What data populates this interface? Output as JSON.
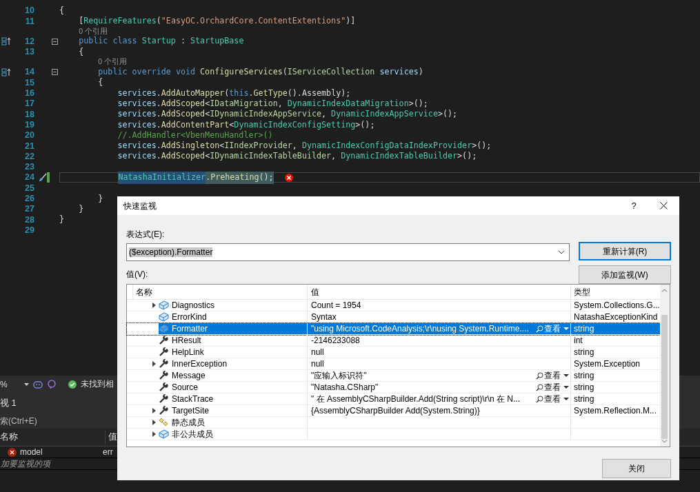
{
  "editor": {
    "lines": [
      {
        "number": "10",
        "fold": false,
        "tokens": [
          {
            "kind": "plain",
            "text": "{"
          }
        ]
      },
      {
        "number": "11",
        "fold": false,
        "tokens": [
          {
            "kind": "plain",
            "text": "    ["
          },
          {
            "kind": "type",
            "text": "RequireFeatures"
          },
          {
            "kind": "plain",
            "text": "("
          },
          {
            "kind": "str",
            "text": "\"EasyOC.OrchardCore.ContentExtentions\""
          },
          {
            "kind": "plain",
            "text": ")]"
          }
        ]
      },
      {
        "number": "12",
        "fold": true,
        "lens": "0 个引用",
        "kind": "override",
        "tokens": [
          {
            "kind": "kw",
            "text": "    public class "
          },
          {
            "kind": "type",
            "text": "Startup"
          },
          {
            "kind": "plain",
            "text": " : "
          },
          {
            "kind": "type",
            "text": "StartupBase"
          }
        ]
      },
      {
        "number": "13",
        "fold": false,
        "tokens": [
          {
            "kind": "plain",
            "text": "    {"
          }
        ]
      },
      {
        "number": "14",
        "fold": true,
        "lens": "0 个引用",
        "kind": "override",
        "tokens": [
          {
            "kind": "kw",
            "text": "        public override void "
          },
          {
            "kind": "method",
            "text": "ConfigureServices"
          },
          {
            "kind": "plain",
            "text": "("
          },
          {
            "kind": "iface",
            "text": "IServiceCollection"
          },
          {
            "kind": "var",
            "text": " services"
          },
          {
            "kind": "plain",
            "text": ")"
          }
        ]
      },
      {
        "number": "15",
        "fold": false,
        "tokens": [
          {
            "kind": "plain",
            "text": "        {"
          }
        ]
      },
      {
        "number": "16",
        "fold": false,
        "tokens": [
          {
            "kind": "var",
            "text": "            services"
          },
          {
            "kind": "plain",
            "text": "."
          },
          {
            "kind": "method",
            "text": "AddAutoMapper"
          },
          {
            "kind": "plain",
            "text": "("
          },
          {
            "kind": "kw",
            "text": "this"
          },
          {
            "kind": "plain",
            "text": "."
          },
          {
            "kind": "method",
            "text": "GetType"
          },
          {
            "kind": "plain",
            "text": "().Assembly);"
          }
        ]
      },
      {
        "number": "17",
        "fold": false,
        "tokens": [
          {
            "kind": "var",
            "text": "            services"
          },
          {
            "kind": "plain",
            "text": "."
          },
          {
            "kind": "method",
            "text": "AddScoped"
          },
          {
            "kind": "plain",
            "text": "<"
          },
          {
            "kind": "iface",
            "text": "IDataMigration"
          },
          {
            "kind": "plain",
            "text": ", "
          },
          {
            "kind": "type",
            "text": "DynamicIndexDataMigration"
          },
          {
            "kind": "plain",
            "text": ">();"
          }
        ]
      },
      {
        "number": "18",
        "fold": false,
        "tokens": [
          {
            "kind": "var",
            "text": "            services"
          },
          {
            "kind": "plain",
            "text": "."
          },
          {
            "kind": "method",
            "text": "AddScoped"
          },
          {
            "kind": "plain",
            "text": "<"
          },
          {
            "kind": "iface",
            "text": "IDynamicIndexAppService"
          },
          {
            "kind": "plain",
            "text": ", "
          },
          {
            "kind": "type",
            "text": "DynamicIndexAppService"
          },
          {
            "kind": "plain",
            "text": ">();"
          }
        ]
      },
      {
        "number": "19",
        "fold": false,
        "tokens": [
          {
            "kind": "var",
            "text": "            services"
          },
          {
            "kind": "plain",
            "text": "."
          },
          {
            "kind": "method",
            "text": "AddContentPart"
          },
          {
            "kind": "plain",
            "text": "<"
          },
          {
            "kind": "type",
            "text": "DynamicIndexConfigSetting"
          },
          {
            "kind": "plain",
            "text": ">();"
          }
        ]
      },
      {
        "number": "20",
        "fold": false,
        "tokens": [
          {
            "kind": "comment",
            "text": "            //.AddHandler<VbenMenuHandler>()"
          }
        ]
      },
      {
        "number": "21",
        "fold": false,
        "tokens": [
          {
            "kind": "var",
            "text": "            services"
          },
          {
            "kind": "plain",
            "text": "."
          },
          {
            "kind": "method",
            "text": "AddSingleton"
          },
          {
            "kind": "plain",
            "text": "<"
          },
          {
            "kind": "iface",
            "text": "IIndexProvider"
          },
          {
            "kind": "plain",
            "text": ", "
          },
          {
            "kind": "type",
            "text": "DynamicIndexConfigDataIndexProvider"
          },
          {
            "kind": "plain",
            "text": ">();"
          }
        ]
      },
      {
        "number": "22",
        "fold": false,
        "tokens": [
          {
            "kind": "var",
            "text": "            services"
          },
          {
            "kind": "plain",
            "text": "."
          },
          {
            "kind": "method",
            "text": "AddScoped"
          },
          {
            "kind": "plain",
            "text": "<"
          },
          {
            "kind": "iface",
            "text": "IDynamicIndexTableBuilder"
          },
          {
            "kind": "plain",
            "text": ", "
          },
          {
            "kind": "type",
            "text": "DynamicIndexTableBuilder"
          },
          {
            "kind": "plain",
            "text": ">();"
          }
        ]
      },
      {
        "number": "23",
        "fold": false
      },
      {
        "number": "24",
        "fold": false,
        "kind": "edit",
        "current": true,
        "error": true,
        "tokens": [
          {
            "kind": "type",
            "text": "            NatashaInitializer",
            "selected": true
          },
          {
            "kind": "method",
            "text": ".Preheating",
            "selected": false
          },
          {
            "kind": "plain",
            "text": "();",
            "selected": false
          }
        ]
      },
      {
        "number": "25",
        "fold": false
      },
      {
        "number": "26",
        "fold": false,
        "tokens": [
          {
            "kind": "plain",
            "text": "        }"
          }
        ]
      },
      {
        "number": "27",
        "fold": false,
        "tokens": [
          {
            "kind": "plain",
            "text": "    }"
          }
        ]
      },
      {
        "number": "28",
        "fold": false,
        "tokens": [
          {
            "kind": "plain",
            "text": "}"
          }
        ]
      },
      {
        "number": "29",
        "fold": false
      }
    ]
  },
  "toolbar": {
    "zoom": "%",
    "status": "未找到相"
  },
  "watch": {
    "title": "视 1",
    "search": "索(Ctrl+E)",
    "columns": [
      "名称",
      "值"
    ],
    "rows": [
      {
        "name": "model",
        "value": "err",
        "error": true
      }
    ],
    "add_hint": "加要监视的项"
  },
  "dialog": {
    "title": "快速监视",
    "help": "?",
    "expression_label": "表达式(E):",
    "expression": "($exception).Formatter",
    "buttons": [
      {
        "label": "重新计算(R)",
        "focused": true
      },
      {
        "label": "添加监视(W)",
        "focused": false
      }
    ],
    "value_label": "值(V):",
    "columns": [
      "名称",
      "值",
      "类型"
    ],
    "rows": [
      {
        "kind": "cube",
        "expandable": true,
        "name": "Diagnostics",
        "value": "Count = 1954",
        "type": "System.Collections.G...",
        "selected": false
      },
      {
        "kind": "cube",
        "expandable": false,
        "name": "ErrorKind",
        "value": "Syntax",
        "type": "NatashaExceptionKind",
        "selected": false
      },
      {
        "kind": "cube",
        "expandable": false,
        "name": "Formatter",
        "value": "\"using Microsoft.CodeAnalysis;\\r\\nusing System.Runtime....",
        "view": "查看",
        "type": "string",
        "selected": true
      },
      {
        "kind": "wrench",
        "expandable": false,
        "name": "HResult",
        "value": "-2146233088",
        "type": "int",
        "selected": false
      },
      {
        "kind": "wrench",
        "expandable": false,
        "name": "HelpLink",
        "value": "null",
        "type": "string",
        "selected": false
      },
      {
        "kind": "wrench",
        "expandable": true,
        "name": "InnerException",
        "value": "null",
        "type": "System.Exception",
        "selected": false
      },
      {
        "kind": "wrench",
        "expandable": false,
        "name": "Message",
        "value": "\"应输入标识符\"",
        "view": "查看",
        "type": "string",
        "selected": false
      },
      {
        "kind": "wrench",
        "expandable": false,
        "name": "Source",
        "value": "\"Natasha.CSharp\"",
        "view": "查看",
        "type": "string",
        "selected": false
      },
      {
        "kind": "wrench",
        "expandable": false,
        "name": "StackTrace",
        "value": "\"   在 AssemblyCSharpBuilder.Add(String script)\\r\\n   在 N...",
        "view": "查看",
        "type": "string",
        "selected": false
      },
      {
        "kind": "wrench",
        "expandable": true,
        "name": "TargetSite",
        "value": "{AssemblyCSharpBuilder Add(System.String)}",
        "type": "System.Reflection.M...",
        "selected": false
      },
      {
        "kind": "static",
        "expandable": true,
        "name": "静态成员",
        "selected": false
      },
      {
        "kind": "cube",
        "expandable": true,
        "name": "非公共成员",
        "selected": false
      }
    ],
    "close": "关闭"
  }
}
